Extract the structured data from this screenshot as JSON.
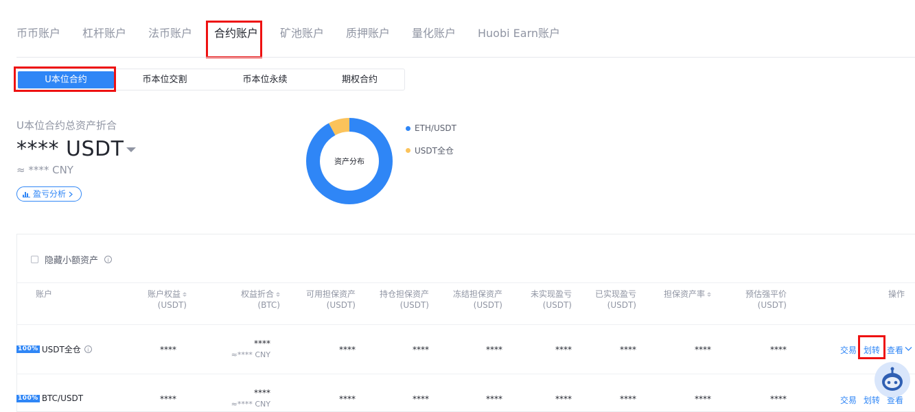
{
  "account_tabs": [
    "币币账户",
    "杠杆账户",
    "法币账户",
    "合约账户",
    "矿池账户",
    "质押账户",
    "量化账户",
    "Huobi Earn账户"
  ],
  "active_account_tab": "合约账户",
  "contract_tabs": [
    "U本位合约",
    "币本位交割",
    "币本位永续",
    "期权合约"
  ],
  "active_contract_tab": "U本位合约",
  "summary": {
    "title": "U本位合约总资产折合",
    "amount": "**** USDT",
    "cny": "≈ **** CNY",
    "pnl_button": "盈亏分析"
  },
  "distribution": {
    "center_label": "资产分布",
    "legend": [
      {
        "name": "ETH/USDT",
        "color": "#2f86f6",
        "share": 0.92
      },
      {
        "name": "USDT全仓",
        "color": "#fbc35b",
        "share": 0.08
      }
    ]
  },
  "filter": {
    "hide_small_label": "隐藏小额资产"
  },
  "table": {
    "headers": {
      "account": "账户",
      "equity": [
        "账户权益",
        "(USDT)"
      ],
      "equity_btc": [
        "权益折合",
        "(BTC)"
      ],
      "available_margin": [
        "可用担保资产",
        "(USDT)"
      ],
      "position_margin": [
        "持仓担保资产",
        "(USDT)"
      ],
      "frozen_margin": [
        "冻结担保资产",
        "(USDT)"
      ],
      "unrealized_pnl": [
        "未实现盈亏",
        "(USDT)"
      ],
      "realized_pnl": [
        "已实现盈亏",
        "(USDT)"
      ],
      "margin_ratio": "担保资产率",
      "est_liq_price": [
        "预估强平价",
        "(USDT)"
      ],
      "action": "操作"
    },
    "rows": [
      {
        "tag": "100%",
        "name": "USDT全仓",
        "equity": "****",
        "equity_btc": "****",
        "equity_cny": "≈**** CNY",
        "available_margin": "****",
        "position_margin": "****",
        "frozen_margin": "****",
        "unrealized_pnl": "****",
        "realized_pnl": "****",
        "margin_ratio": "****",
        "est_liq_price": "****",
        "actions": [
          "交易",
          "划转",
          "查看"
        ]
      },
      {
        "tag": "100%",
        "name": "BTC/USDT",
        "equity": "****",
        "equity_btc": "****",
        "equity_cny": "≈**** CNY",
        "available_margin": "****",
        "position_margin": "****",
        "frozen_margin": "****",
        "unrealized_pnl": "****",
        "realized_pnl": "****",
        "margin_ratio": "****",
        "est_liq_price": "****",
        "actions": [
          "交易",
          "划转",
          "查看"
        ]
      }
    ]
  },
  "colors": {
    "accent": "#2f86f6",
    "highlight_box": "#ee1111",
    "secondary": "#fbc35b"
  }
}
